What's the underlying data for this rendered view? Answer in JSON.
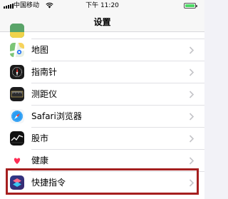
{
  "status_bar": {
    "carrier": "中国移动",
    "time": "下午 11:20",
    "signal_icon": "cellular-signal-icon",
    "wifi_icon": "wifi-icon",
    "battery_icon": "battery-icon",
    "battery_level_percent": 100,
    "battery_color": "#4cd964"
  },
  "nav_bar": {
    "title": "设置"
  },
  "settings_list": {
    "items": [
      {
        "label": "地图",
        "icon": "maps-app-icon"
      },
      {
        "label": "指南针",
        "icon": "compass-app-icon"
      },
      {
        "label": "测距仪",
        "icon": "measure-app-icon"
      },
      {
        "label": "Safari浏览器",
        "icon": "safari-app-icon"
      },
      {
        "label": "股市",
        "icon": "stocks-app-icon"
      },
      {
        "label": "健康",
        "icon": "health-app-icon"
      },
      {
        "label": "快捷指令",
        "icon": "shortcuts-app-icon"
      }
    ],
    "chevron_icon": "chevron-right-icon",
    "highlighted_item": "快捷指令",
    "highlight_color": "#a51f1f"
  }
}
